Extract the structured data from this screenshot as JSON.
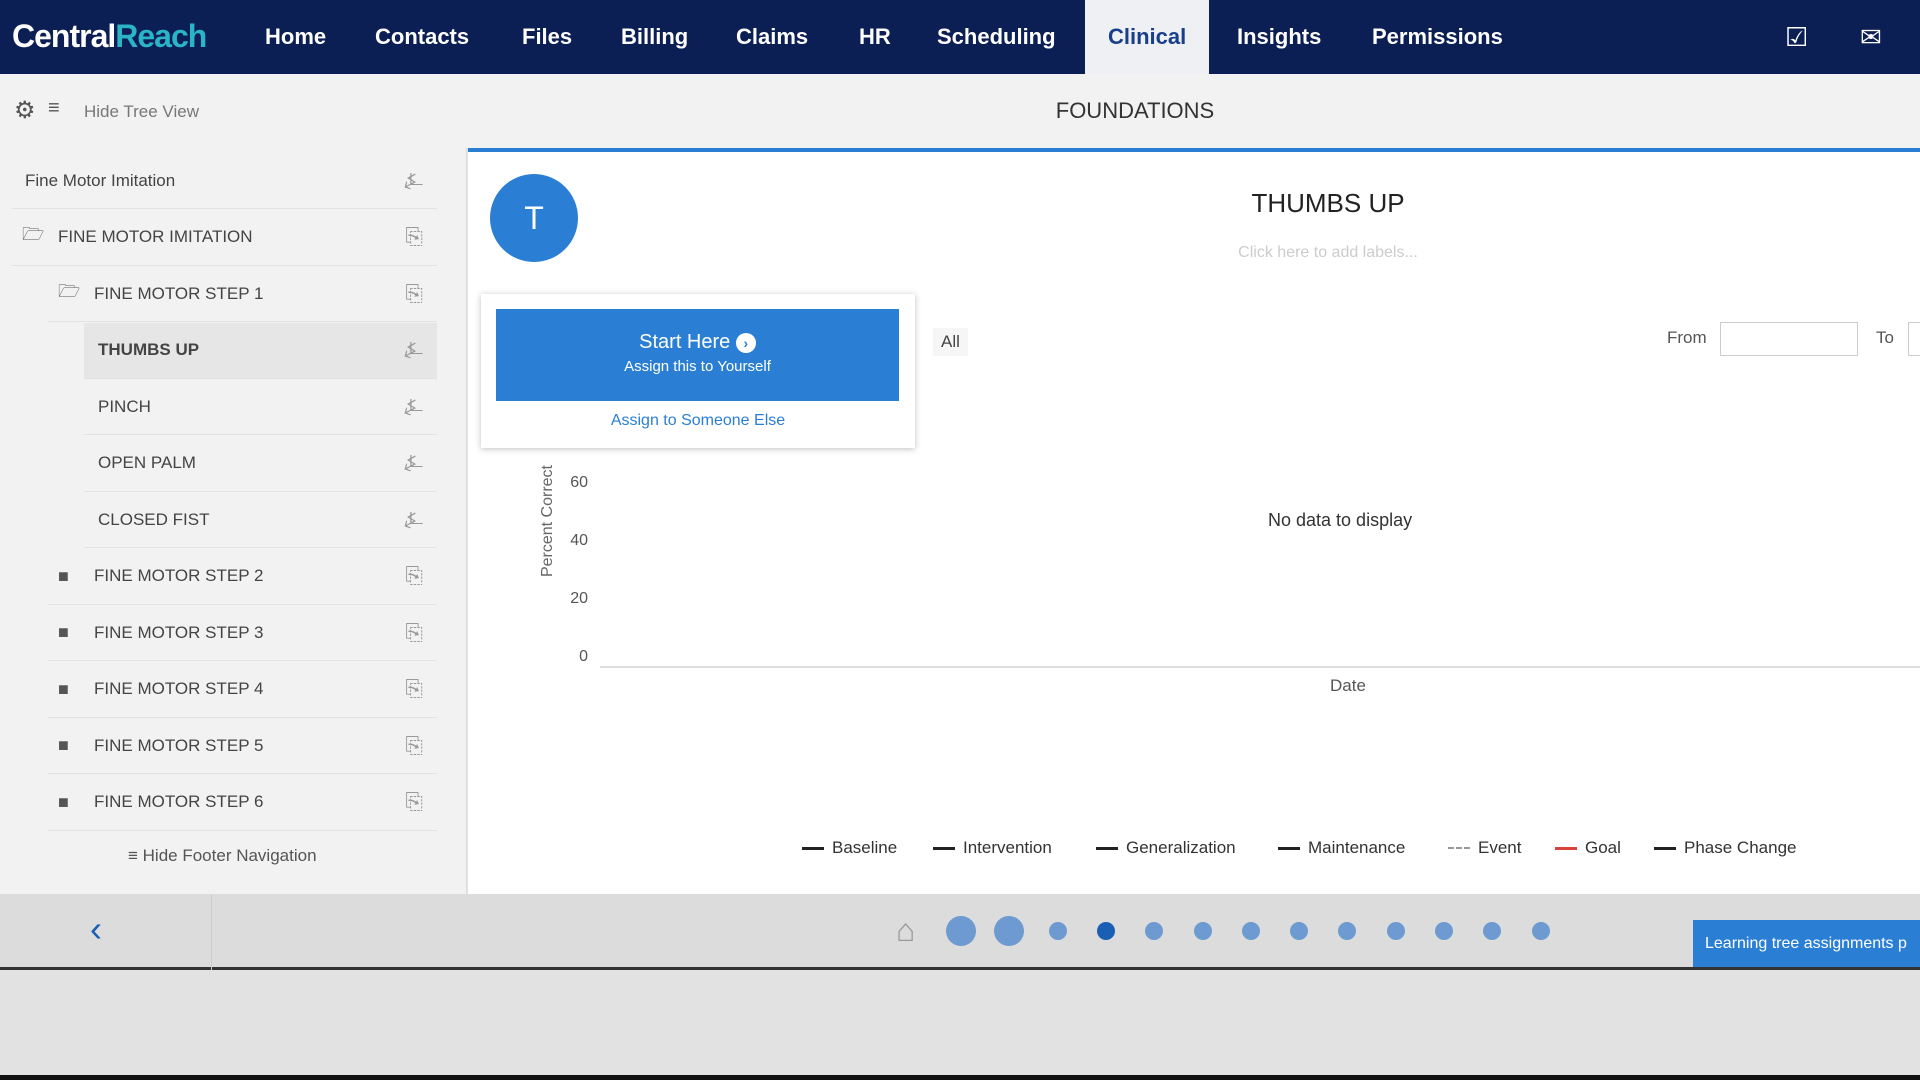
{
  "nav": {
    "logo_a": "Central",
    "logo_b": "Reach",
    "items": [
      "Home",
      "Contacts",
      "Files",
      "Billing",
      "Claims",
      "HR",
      "Scheduling",
      "Clinical",
      "Insights",
      "Permissions"
    ],
    "active": "Clinical",
    "icons": [
      "checklist-icon",
      "mail-icon"
    ]
  },
  "toolbar": {
    "hide_tree": "Hide Tree View",
    "section_title": "FOUNDATIONS"
  },
  "tree": {
    "items": [
      {
        "label": "Fine Motor Imitation",
        "level": 0,
        "type": "header"
      },
      {
        "label": "FINE MOTOR IMITATION",
        "level": 0,
        "type": "folder-open"
      },
      {
        "label": "FINE MOTOR STEP 1",
        "level": 1,
        "type": "folder-open"
      },
      {
        "label": "THUMBS UP",
        "level": 2,
        "type": "target",
        "selected": true
      },
      {
        "label": "PINCH",
        "level": 2,
        "type": "target"
      },
      {
        "label": "OPEN PALM",
        "level": 2,
        "type": "target"
      },
      {
        "label": "CLOSED FIST",
        "level": 2,
        "type": "target"
      },
      {
        "label": "FINE MOTOR STEP 2",
        "level": 1,
        "type": "folder"
      },
      {
        "label": "FINE MOTOR STEP 3",
        "level": 1,
        "type": "folder"
      },
      {
        "label": "FINE MOTOR STEP 4",
        "level": 1,
        "type": "folder"
      },
      {
        "label": "FINE MOTOR STEP 5",
        "level": 1,
        "type": "folder"
      },
      {
        "label": "FINE MOTOR STEP 6",
        "level": 1,
        "type": "folder"
      }
    ],
    "hide_footer": "Hide Footer Navigation"
  },
  "detail": {
    "avatar": "T",
    "title": "THUMBS UP",
    "labels_placeholder": "Click here to add labels...",
    "filter_all": "All",
    "from_label": "From",
    "from_value": "",
    "to_label": "To",
    "popover": {
      "start": "Start Here",
      "assign_self": "Assign this to Yourself",
      "assign_other": "Assign to Someone Else"
    }
  },
  "chart_data": {
    "type": "line",
    "ylabel": "Percent Correct",
    "xlabel": "Date",
    "yticks": [
      "60",
      "40",
      "20",
      "0"
    ],
    "series": [],
    "empty_message": "No data to display",
    "legend": [
      {
        "name": "Baseline",
        "color": "#222222"
      },
      {
        "name": "Intervention",
        "color": "#222222"
      },
      {
        "name": "Generalization",
        "color": "#222222"
      },
      {
        "name": "Maintenance",
        "color": "#222222"
      },
      {
        "name": "Event",
        "color": "#999999"
      },
      {
        "name": "Goal",
        "color": "#d9443a"
      },
      {
        "name": "Phase Change",
        "color": "#222222"
      }
    ]
  },
  "footer": {
    "step_count": 13,
    "active_step": 4,
    "assignments_button": "Learning tree assignments p"
  },
  "colors": {
    "nav": "#0c1f55",
    "accent": "#2a7fd4"
  }
}
